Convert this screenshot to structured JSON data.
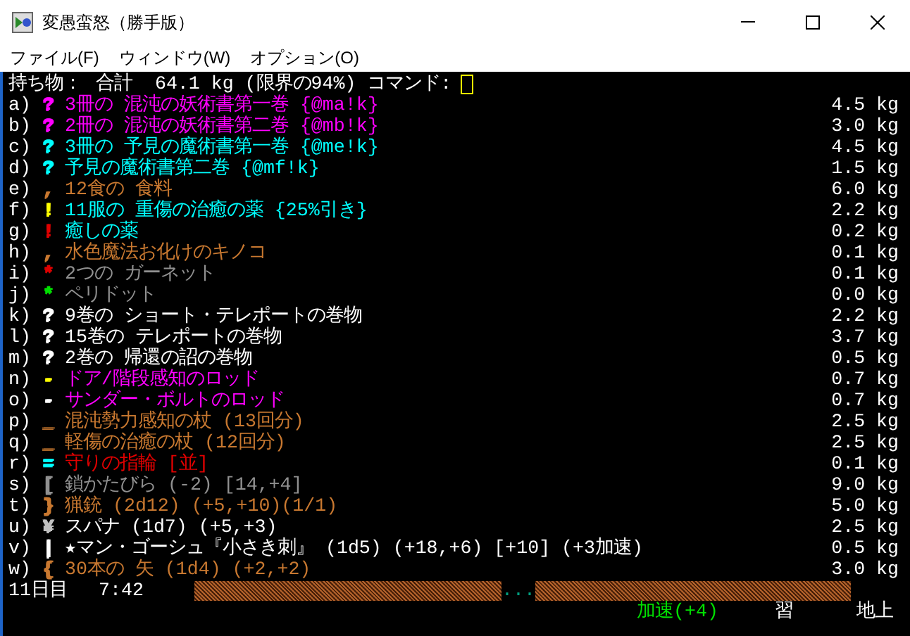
{
  "window": {
    "title": "変愚蛮怒（勝手版）"
  },
  "menu": [
    "ファイル(F)",
    "ウィンドウ(W)",
    "オプション(O)"
  ],
  "header": {
    "label": "持ち物：",
    "total": "合計  64.1 kg (限界の94%) コマンド:"
  },
  "items": [
    {
      "letter": "a)",
      "symbol": {
        "text": "?",
        "color": "#ff00ff"
      },
      "name": "3冊の 混沌の妖術書第一巻 {@ma!k}",
      "color": "#ff00ff",
      "weight": "4.5 kg"
    },
    {
      "letter": "b)",
      "symbol": {
        "text": "?",
        "color": "#ff00ff"
      },
      "name": "2冊の 混沌の妖術書第二巻 {@mb!k}",
      "color": "#ff00ff",
      "weight": "3.0 kg"
    },
    {
      "letter": "c)",
      "symbol": {
        "text": "?",
        "color": "#00ffff"
      },
      "name": "3冊の 予見の魔術書第一巻 {@me!k}",
      "color": "#00ffff",
      "weight": "4.5 kg"
    },
    {
      "letter": "d)",
      "symbol": {
        "text": "?",
        "color": "#00ffff"
      },
      "name": "予見の魔術書第二巻 {@mf!k}",
      "color": "#00ffff",
      "weight": "1.5 kg"
    },
    {
      "letter": "e)",
      "symbol": {
        "text": ",",
        "color": "#c87830"
      },
      "name": "12食の 食料",
      "color": "#c87830",
      "weight": "6.0 kg"
    },
    {
      "letter": "f)",
      "symbol": {
        "text": "!",
        "color": "#ffff00"
      },
      "name": "11服の 重傷の治癒の薬 {25%引き}",
      "color": "#00ffff",
      "weight": "2.2 kg"
    },
    {
      "letter": "g)",
      "symbol": {
        "text": "!",
        "color": "#e00000"
      },
      "name": "癒しの薬",
      "color": "#00ffff",
      "weight": "0.2 kg"
    },
    {
      "letter": "h)",
      "symbol": {
        "text": ",",
        "color": "#c87830"
      },
      "name": "水色魔法お化けのキノコ",
      "color": "#c87830",
      "weight": "0.1 kg"
    },
    {
      "letter": "i)",
      "symbol": {
        "text": "*",
        "color": "#e00000"
      },
      "name": "2つの ガーネット",
      "color": "#909090",
      "weight": "0.1 kg"
    },
    {
      "letter": "j)",
      "symbol": {
        "text": "*",
        "color": "#00e000"
      },
      "name": "ペリドット",
      "color": "#909090",
      "weight": "0.0 kg"
    },
    {
      "letter": "k)",
      "symbol": {
        "text": "?",
        "color": "#ffffff"
      },
      "name": "9巻の ショート・テレポートの巻物",
      "color": "#ffffff",
      "weight": "2.2 kg"
    },
    {
      "letter": "l)",
      "symbol": {
        "text": "?",
        "color": "#ffffff"
      },
      "name": "15巻の テレポートの巻物",
      "color": "#ffffff",
      "weight": "3.7 kg"
    },
    {
      "letter": "m)",
      "symbol": {
        "text": "?",
        "color": "#ffffff"
      },
      "name": "2巻の 帰還の詔の巻物",
      "color": "#ffffff",
      "weight": "0.5 kg"
    },
    {
      "letter": "n)",
      "symbol": {
        "text": "-",
        "color": "#ffff00"
      },
      "name": "ドア/階段感知のロッド",
      "color": "#ff00ff",
      "weight": "0.7 kg"
    },
    {
      "letter": "o)",
      "symbol": {
        "text": "-",
        "color": "#ffffff"
      },
      "name": "サンダー・ボルトのロッド",
      "color": "#ff00ff",
      "weight": "0.7 kg"
    },
    {
      "letter": "p)",
      "symbol": {
        "text": "_",
        "color": "#c87830"
      },
      "name": "混沌勢力感知の杖 (13回分)",
      "color": "#c87830",
      "weight": "2.5 kg"
    },
    {
      "letter": "q)",
      "symbol": {
        "text": "_",
        "color": "#c87830"
      },
      "name": "軽傷の治癒の杖 (12回分)",
      "color": "#c87830",
      "weight": "2.5 kg"
    },
    {
      "letter": "r)",
      "symbol": {
        "text": "=",
        "color": "#00ffff"
      },
      "name": "守りの指輪 [並]",
      "color": "#e00000",
      "weight": "0.1 kg"
    },
    {
      "letter": "s)",
      "symbol": {
        "text": "[",
        "color": "#909090"
      },
      "name": "鎖かたびら (-2) [14,+4]",
      "color": "#909090",
      "weight": "9.0 kg"
    },
    {
      "letter": "t)",
      "symbol": {
        "text": "}",
        "color": "#c87830"
      },
      "name": "猟銃 (2d12) (+5,+10)(1/1)",
      "color": "#c87830",
      "weight": "5.0 kg"
    },
    {
      "letter": "u)",
      "symbol": {
        "text": "¥",
        "color": "#c0c0c0"
      },
      "name": "スパナ (1d7) (+5,+3)",
      "color": "#ffffff",
      "weight": "2.5 kg"
    },
    {
      "letter": "v)",
      "symbol": {
        "text": "|",
        "color": "#ffffff"
      },
      "name": "★マン・ゴーシュ『小さき刺』 (1d5) (+18,+6) [+10] (+3加速)",
      "color": "#ffffff",
      "weight": "0.5 kg"
    },
    {
      "letter": "w)",
      "symbol": {
        "text": "{",
        "color": "#c87830"
      },
      "name": "30本の 矢 (1d4) (+2,+2)",
      "color": "#c87830",
      "weight": "3.0 kg"
    }
  ],
  "status": {
    "day": "11日目",
    "time": "7:42",
    "gap": "...",
    "speed": "加速(+4)",
    "study": "習",
    "level": "地上"
  }
}
